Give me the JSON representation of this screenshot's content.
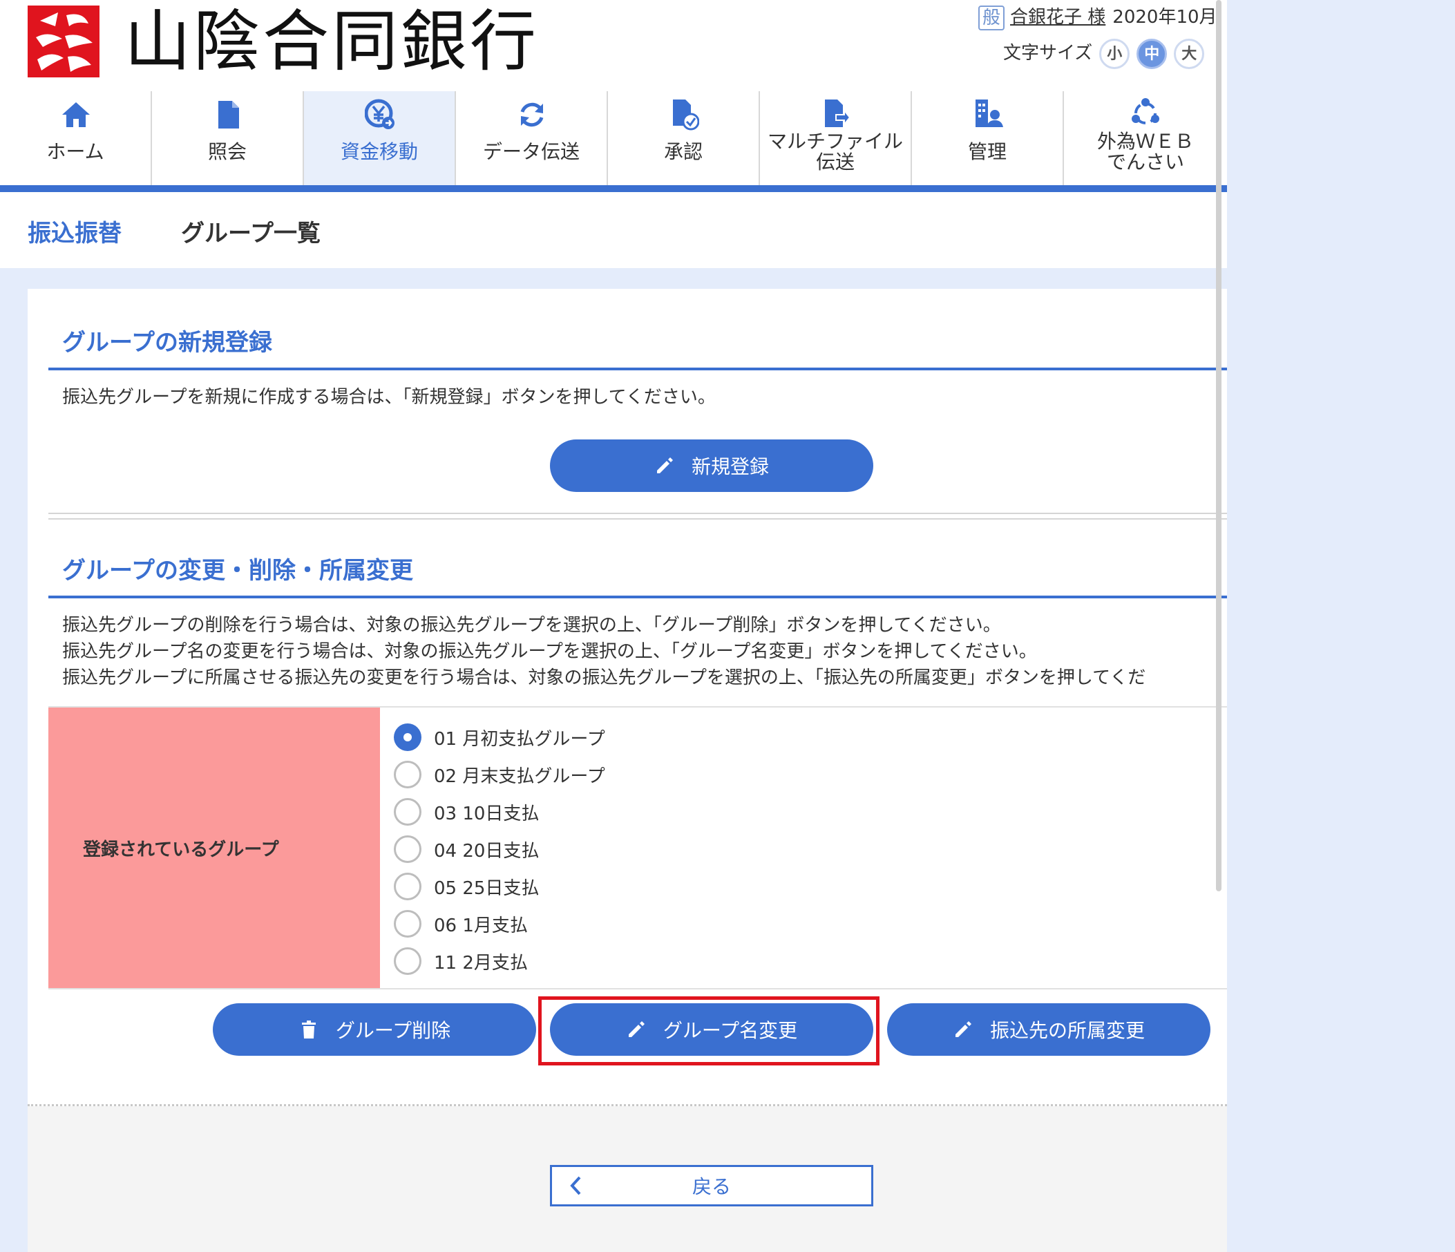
{
  "header": {
    "bank_name": "山陰合同銀行",
    "user_badge": "般",
    "user_name": "合銀花子 様",
    "date": "2020年10月",
    "font_size_label": "文字サイズ",
    "font_sizes": [
      "小",
      "中",
      "大"
    ]
  },
  "nav": {
    "items": [
      {
        "label": "ホーム",
        "icon": "home-icon"
      },
      {
        "label": "照会",
        "icon": "document-icon"
      },
      {
        "label": "資金移動",
        "icon": "yen-transfer-icon"
      },
      {
        "label": "データ伝送",
        "icon": "sync-icon"
      },
      {
        "label": "承認",
        "icon": "approve-icon"
      },
      {
        "label": "マルチファイル",
        "label2": "伝送",
        "icon": "file-upload-icon"
      },
      {
        "label": "管理",
        "icon": "admin-icon"
      },
      {
        "label": "外為ＷＥＢ",
        "label2": "でんさい",
        "icon": "network-icon"
      }
    ]
  },
  "breadcrumb": {
    "parent": "振込振替",
    "current": "グループ一覧"
  },
  "section_new": {
    "title": "グループの新規登録",
    "desc": "振込先グループを新規に作成する場合は、「新規登録」ボタンを押してください。",
    "button": "新規登録"
  },
  "section_edit": {
    "title": "グループの変更・削除・所属変更",
    "desc1": "振込先グループの削除を行う場合は、対象の振込先グループを選択の上、「グループ削除」ボタンを押してください。",
    "desc2": "振込先グループ名の変更を行う場合は、対象の振込先グループを選択の上、「グループ名変更」ボタンを押してください。",
    "desc3": "振込先グループに所属させる振込先の変更を行う場合は、対象の振込先グループを選択の上、「振込先の所属変更」ボタンを押してくだ",
    "table_header": "登録されているグループ",
    "groups": [
      {
        "label": "01 月初支払グループ",
        "checked": true
      },
      {
        "label": "02 月末支払グループ",
        "checked": false
      },
      {
        "label": "03 10日支払",
        "checked": false
      },
      {
        "label": "04 20日支払",
        "checked": false
      },
      {
        "label": "05 25日支払",
        "checked": false
      },
      {
        "label": "06 1月支払",
        "checked": false
      },
      {
        "label": "11 2月支払",
        "checked": false
      }
    ],
    "btn_delete": "グループ削除",
    "btn_rename": "グループ名変更",
    "btn_membership": "振込先の所属変更"
  },
  "footer": {
    "back": "戻る"
  },
  "colors": {
    "accent": "#3a6fd0",
    "header_cell": "#fb9a9a",
    "highlight": "#e0141e",
    "page_bg": "#e4ecfb"
  }
}
